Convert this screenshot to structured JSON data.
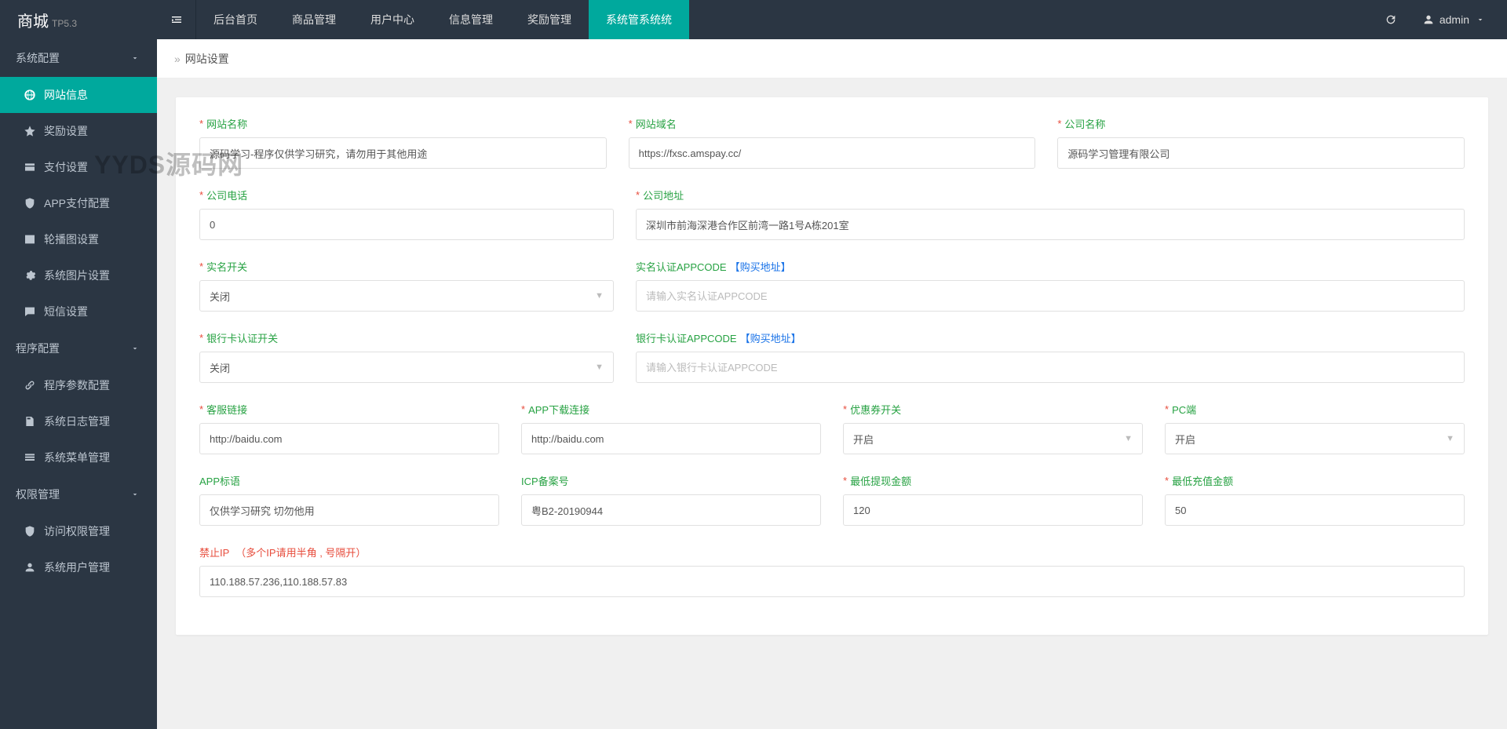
{
  "brand": {
    "name": "商城",
    "version": "TP5.3"
  },
  "topNav": {
    "items": [
      "后台首页",
      "商品管理",
      "用户中心",
      "信息管理",
      "奖励管理",
      "系统管系统统"
    ],
    "activeIndex": 5
  },
  "user": {
    "name": "admin"
  },
  "sidebar": {
    "groups": [
      {
        "label": "系统配置",
        "items": [
          {
            "label": "网站信息",
            "icon": "globe",
            "active": true
          },
          {
            "label": "奖励设置",
            "icon": "star"
          },
          {
            "label": "支付设置",
            "icon": "card"
          },
          {
            "label": "APP支付配置",
            "icon": "shield"
          },
          {
            "label": "轮播图设置",
            "icon": "image"
          },
          {
            "label": "系统图片设置",
            "icon": "gear"
          },
          {
            "label": "短信设置",
            "icon": "message"
          }
        ]
      },
      {
        "label": "程序配置",
        "items": [
          {
            "label": "程序参数配置",
            "icon": "link"
          },
          {
            "label": "系统日志管理",
            "icon": "doc"
          },
          {
            "label": "系统菜单管理",
            "icon": "menu"
          }
        ]
      },
      {
        "label": "权限管理",
        "items": [
          {
            "label": "访问权限管理",
            "icon": "shield"
          },
          {
            "label": "系统用户管理",
            "icon": "user"
          }
        ]
      }
    ]
  },
  "breadcrumb": "网站设置",
  "form": {
    "site_name": {
      "label": "网站名称",
      "value": "源码学习-程序仅供学习研究，请勿用于其他用途"
    },
    "site_domain": {
      "label": "网站域名",
      "value": "https://fxsc.amspay.cc/"
    },
    "company_name": {
      "label": "公司名称",
      "value": "源码学习管理有限公司"
    },
    "company_phone": {
      "label": "公司电话",
      "value": "0"
    },
    "company_addr": {
      "label": "公司地址",
      "value": "深圳市前海深港合作区前湾一路1号A栋201室"
    },
    "realname_switch": {
      "label": "实名开关",
      "value": "关闭"
    },
    "realname_appcode": {
      "label": "实名认证APPCODE",
      "link": "【购买地址】",
      "placeholder": "请输入实名认证APPCODE",
      "value": ""
    },
    "bankcard_switch": {
      "label": "银行卡认证开关",
      "value": "关闭"
    },
    "bankcard_appcode": {
      "label": "银行卡认证APPCODE",
      "link": "【购买地址】",
      "placeholder": "请输入银行卡认证APPCODE",
      "value": ""
    },
    "kefu_link": {
      "label": "客服链接",
      "value": "http://baidu.com"
    },
    "app_download": {
      "label": "APP下载连接",
      "value": "http://baidu.com"
    },
    "coupon_switch": {
      "label": "优惠券开关",
      "value": "开启"
    },
    "pc_switch": {
      "label": "PC端",
      "value": "开启"
    },
    "app_slogan": {
      "label": "APP标语",
      "value": "仅供学习研究 切勿他用"
    },
    "icp": {
      "label": "ICP备案号",
      "value": "粤B2-20190944"
    },
    "min_withdraw": {
      "label": "最低提现金额",
      "value": "120"
    },
    "min_recharge": {
      "label": "最低充值金额",
      "value": "50"
    },
    "ban_ip": {
      "label": "禁止IP",
      "note": "（多个IP请用半角 , 号隔开）",
      "value": "110.188.57.236,110.188.57.83"
    }
  },
  "watermark": "YYDS源码网"
}
